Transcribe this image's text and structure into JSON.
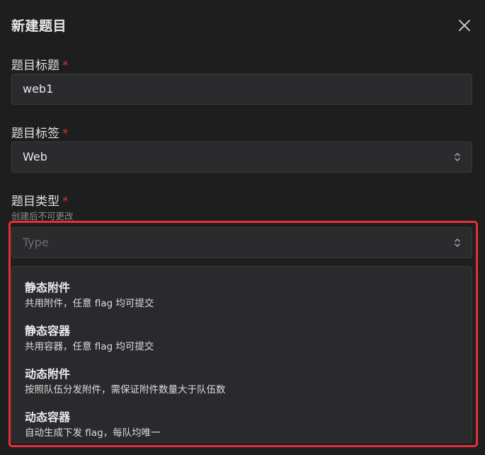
{
  "modal": {
    "title": "新建题目",
    "close_icon": "close-icon"
  },
  "fields": {
    "title": {
      "label": "题目标题",
      "required_mark": "*",
      "value": "web1"
    },
    "tag": {
      "label": "题目标签",
      "required_mark": "*",
      "value": "Web"
    },
    "type": {
      "label": "题目类型",
      "required_mark": "*",
      "hint": "创建后不可更改",
      "placeholder": "Type"
    }
  },
  "dropdown": {
    "options": [
      {
        "title": "静态附件",
        "description": "共用附件，任意 flag 均可提交"
      },
      {
        "title": "静态容器",
        "description": "共用容器，任意 flag 均可提交"
      },
      {
        "title": "动态附件",
        "description": "按照队伍分发附件，需保证附件数量大于队伍数"
      },
      {
        "title": "动态容器",
        "description": "自动生成下发 flag，每队均唯一"
      }
    ]
  },
  "colors": {
    "background": "#1e1e1f",
    "input_background": "#2b2b2d",
    "required": "#e03131",
    "highlight_border": "#e5303a"
  }
}
